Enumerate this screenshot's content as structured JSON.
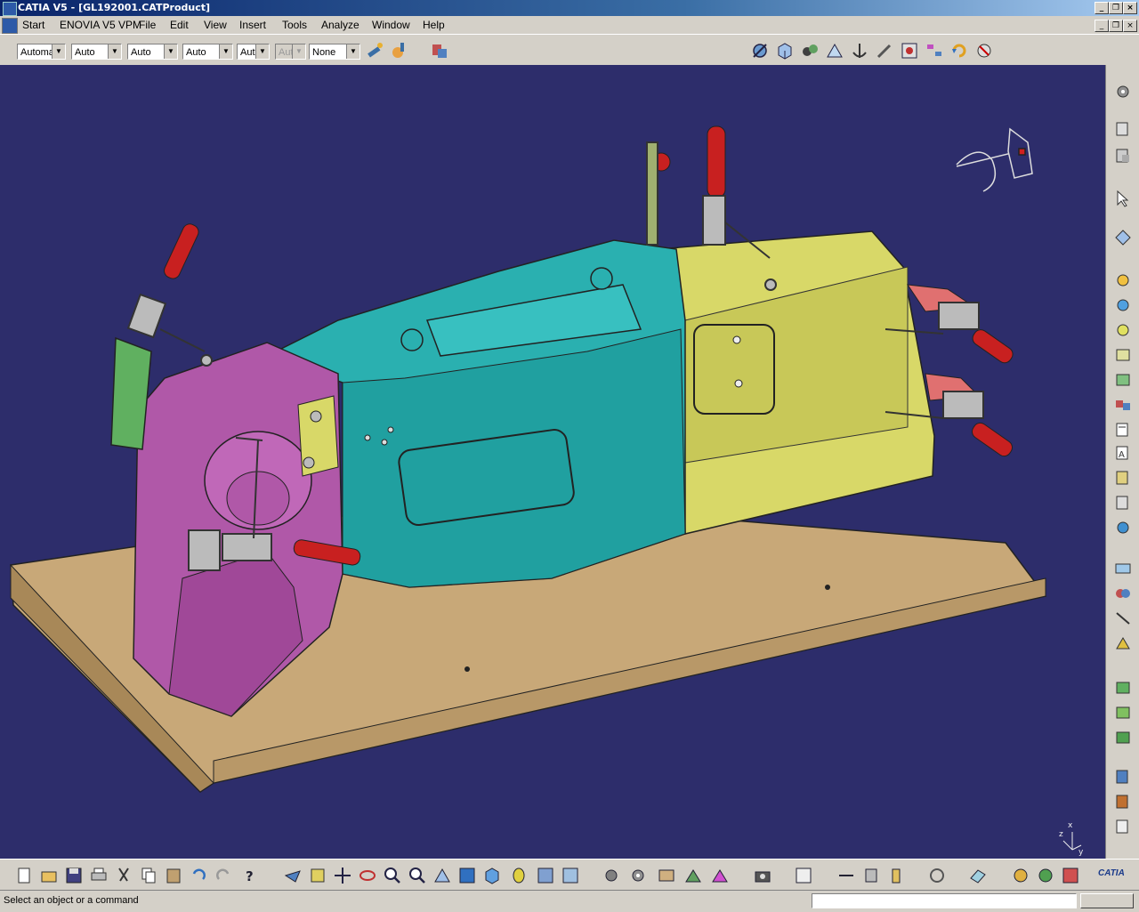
{
  "window": {
    "title": "CATIA V5 - [GL192001.CATProduct]"
  },
  "menu": {
    "start": "Start",
    "enovia": "ENOVIA V5 VPM",
    "file": "File",
    "edit": "Edit",
    "view": "View",
    "insert": "Insert",
    "tools": "Tools",
    "analyze": "Analyze",
    "window": "Window",
    "help": "Help"
  },
  "toolbar": {
    "combo1": "Automa",
    "combo2": "Auto",
    "combo3": "Auto",
    "combo4": "Auto",
    "combo5": "Aut",
    "combo6": "Aut",
    "combo7": "None"
  },
  "status": {
    "prompt": "Select an object or a command"
  },
  "brand": {
    "logo": "CATIA"
  },
  "compass": {
    "axis_x": "x",
    "axis_y": "y",
    "axis_z": "z"
  },
  "colors": {
    "viewport_bg": "#2d2d6b",
    "base_plate": "#c8a878",
    "teal_body": "#2ab0b0",
    "yellow_body": "#d8d868",
    "magenta_body": "#b058a8",
    "clamp_handle": "#c82020"
  }
}
